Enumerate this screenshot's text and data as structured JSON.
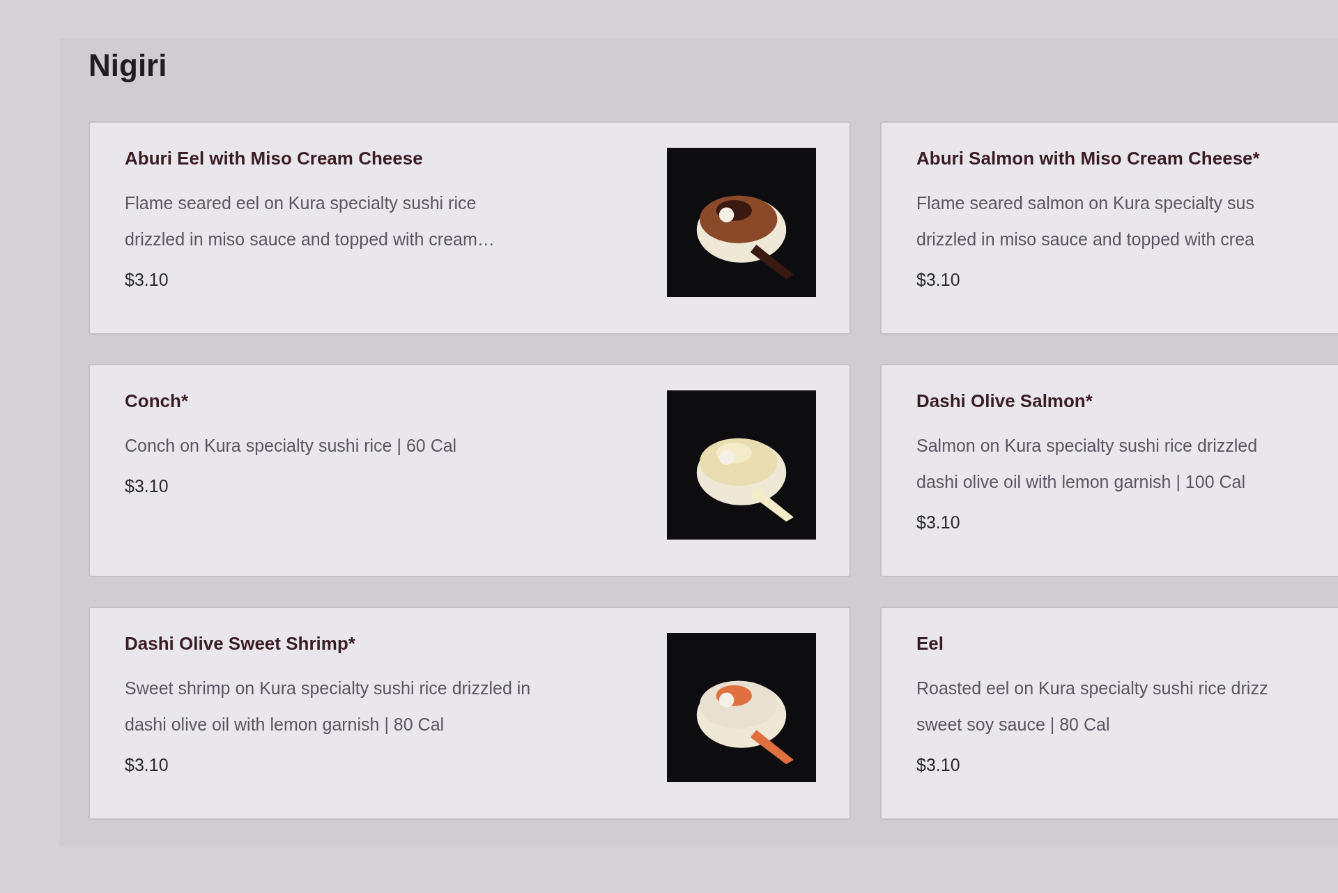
{
  "section": {
    "title": "Nigiri"
  },
  "items": [
    {
      "name": "Aburi Eel with Miso Cream Cheese",
      "description_lines": [
        "Flame seared eel on Kura specialty sushi rice",
        "drizzled in miso sauce and topped with cream…"
      ],
      "price": "$3.10",
      "image": {
        "kind": "picture"
      }
    },
    {
      "name": "Aburi Salmon with Miso Cream Cheese*",
      "description_lines": [
        "Flame seared salmon on Kura specialty sus",
        "drizzled in miso sauce and topped with crea"
      ],
      "price": "$3.10"
    },
    {
      "name": "Conch*",
      "description_lines": [
        "Conch on Kura specialty sushi rice | 60 Cal"
      ],
      "price": "$3.10",
      "image": {
        "kind": "picture"
      }
    },
    {
      "name": "Dashi Olive Salmon*",
      "description_lines": [
        "Salmon on Kura specialty sushi rice drizzled",
        "dashi olive oil with lemon garnish | 100 Cal"
      ],
      "price": "$3.10"
    },
    {
      "name": "Dashi Olive Sweet Shrimp*",
      "description_lines": [
        "Sweet shrimp on Kura specialty sushi rice drizzled in",
        "dashi olive oil with lemon garnish | 80 Cal"
      ],
      "price": "$3.10",
      "image": {
        "kind": "picture"
      }
    },
    {
      "name": "Eel",
      "description_lines": [
        "Roasted eel on Kura specialty sushi rice drizz",
        "sweet soy sauce | 80 Cal"
      ],
      "price": "$3.10"
    }
  ]
}
